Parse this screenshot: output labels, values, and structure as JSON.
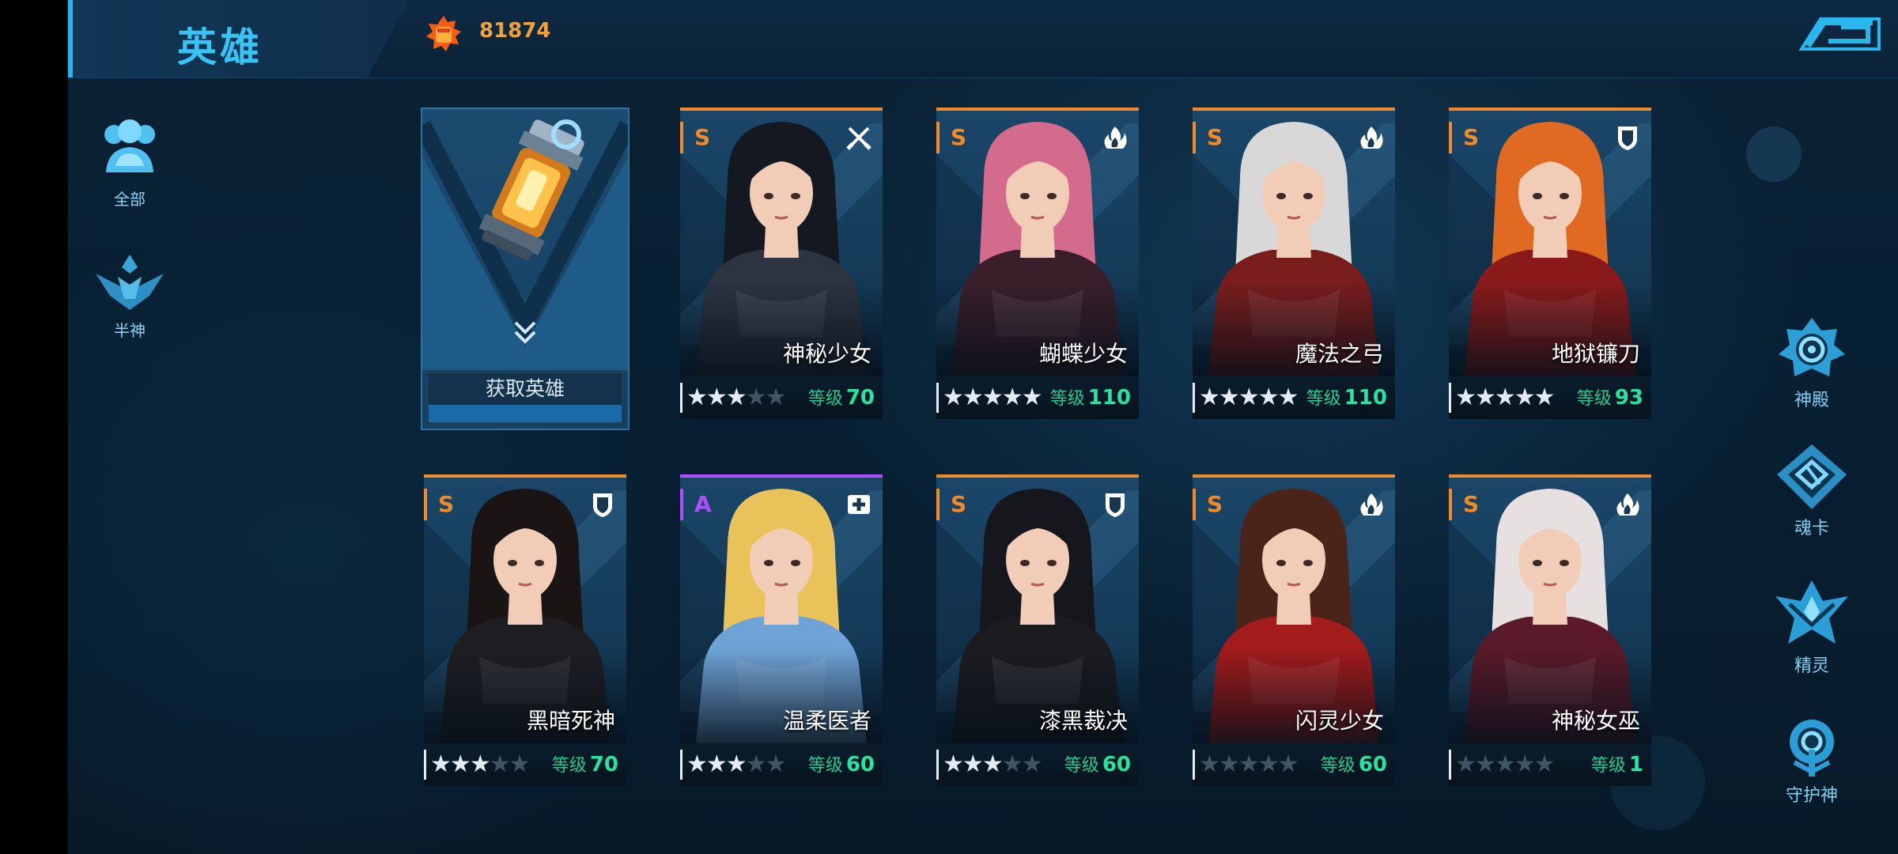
{
  "header": {
    "title": "英雄",
    "currency": {
      "icon": "fist-icon",
      "value": "81874",
      "color": "#f0a13a"
    },
    "back_icon": "back-arrow-icon"
  },
  "left_nav": [
    {
      "label": "全部",
      "icon": "all-heroes-icon",
      "active": true
    },
    {
      "label": "半神",
      "icon": "demigod-icon",
      "active": false
    }
  ],
  "right_nav": [
    {
      "label": "神殿",
      "icon": "temple-icon"
    },
    {
      "label": "魂卡",
      "icon": "soul-card-icon"
    },
    {
      "label": "精灵",
      "icon": "spirit-icon"
    },
    {
      "label": "守护神",
      "icon": "guardian-icon"
    }
  ],
  "get_hero": {
    "label": "获取英雄",
    "icon": "hero-capsule-icon"
  },
  "level_label": "等级",
  "heroes": [
    {
      "name": "神秘少女",
      "rank": "S",
      "class_icon": "swords-icon",
      "stars": 3,
      "max_stars": 5,
      "level": "70"
    },
    {
      "name": "蝴蝶少女",
      "rank": "S",
      "class_icon": "flame-icon",
      "stars": 5,
      "max_stars": 5,
      "level": "110"
    },
    {
      "name": "魔法之弓",
      "rank": "S",
      "class_icon": "flame-icon",
      "stars": 5,
      "max_stars": 5,
      "level": "110"
    },
    {
      "name": "地狱镰刀",
      "rank": "S",
      "class_icon": "shield-icon",
      "stars": 5,
      "max_stars": 5,
      "level": "93"
    },
    {
      "name": "黑暗死神",
      "rank": "S",
      "class_icon": "shield-icon",
      "stars": 3,
      "max_stars": 5,
      "level": "70"
    },
    {
      "name": "温柔医者",
      "rank": "A",
      "class_icon": "heal-cross-icon",
      "stars": 3,
      "max_stars": 5,
      "level": "60"
    },
    {
      "name": "漆黑裁决",
      "rank": "S",
      "class_icon": "shield-icon",
      "stars": 3,
      "max_stars": 5,
      "level": "60"
    },
    {
      "name": "闪灵少女",
      "rank": "S",
      "class_icon": "flame-icon",
      "stars": 0,
      "max_stars": 5,
      "level": "60"
    },
    {
      "name": "神秘女巫",
      "rank": "S",
      "class_icon": "flame-icon",
      "stars": 0,
      "max_stars": 5,
      "level": "1"
    }
  ],
  "colors": {
    "accent": "#36c4f5",
    "rank_s": "#f08a2a",
    "rank_a": "#b04dff",
    "level": "#27e3a0"
  }
}
